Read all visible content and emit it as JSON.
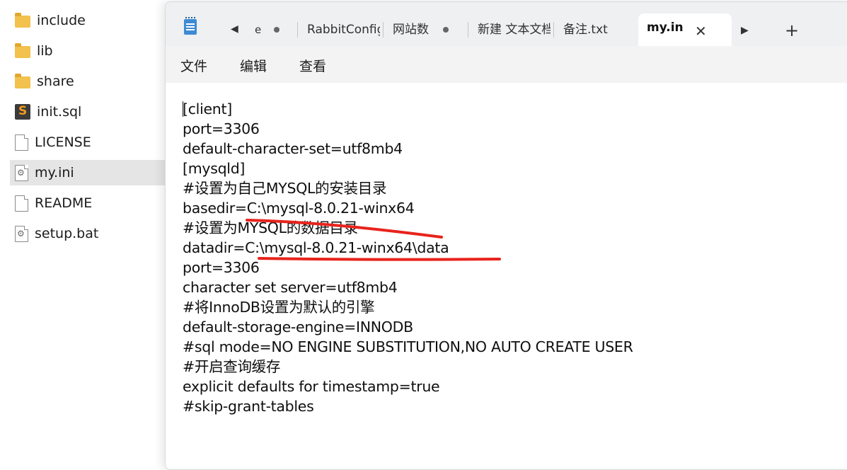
{
  "explorer": {
    "items": [
      {
        "label": "include",
        "icon": "folder-icon"
      },
      {
        "label": "lib",
        "icon": "folder-icon"
      },
      {
        "label": "share",
        "icon": "folder-icon"
      },
      {
        "label": "init.sql",
        "icon": "sublime-file-icon"
      },
      {
        "label": "LICENSE",
        "icon": "document-icon"
      },
      {
        "label": "my.ini",
        "icon": "settings-file-icon",
        "selected": true
      },
      {
        "label": "README",
        "icon": "document-icon"
      },
      {
        "label": "setup.bat",
        "icon": "settings-file-icon"
      }
    ]
  },
  "notepad": {
    "tabs": {
      "nav_left": "◀",
      "partial_first": "e",
      "rabbit": "RabbitConfig",
      "website": "网站数",
      "new_text": "新建 文本文档",
      "notes": "备注.txt",
      "active": "my.in",
      "close": "✕",
      "nav_right": "▶",
      "new_tab": "+"
    },
    "menu": {
      "file": "文件",
      "edit": "编辑",
      "view": "查看"
    },
    "content": {
      "lines": [
        "[client]",
        "port=3306",
        "default-character-set=utf8mb4",
        "[mysqld]",
        "#设置为自己MYSQL的安装目录",
        "basedir=C:\\mysql-8.0.21-winx64",
        "#设置为MYSQL的数据目录",
        "datadir=C:\\mysql-8.0.21-winx64\\data",
        "port=3306",
        "character set server=utf8mb4",
        "#将InnoDB设置为默认的引擎",
        "default-storage-engine=INNODB",
        "#sql mode=NO ENGINE SUBSTITUTION,NO AUTO CREATE USER",
        "#开启查询缓存",
        "explicit defaults for timestamp=true",
        "#skip-grant-tables"
      ]
    },
    "annotation_color": "#e8231c"
  }
}
